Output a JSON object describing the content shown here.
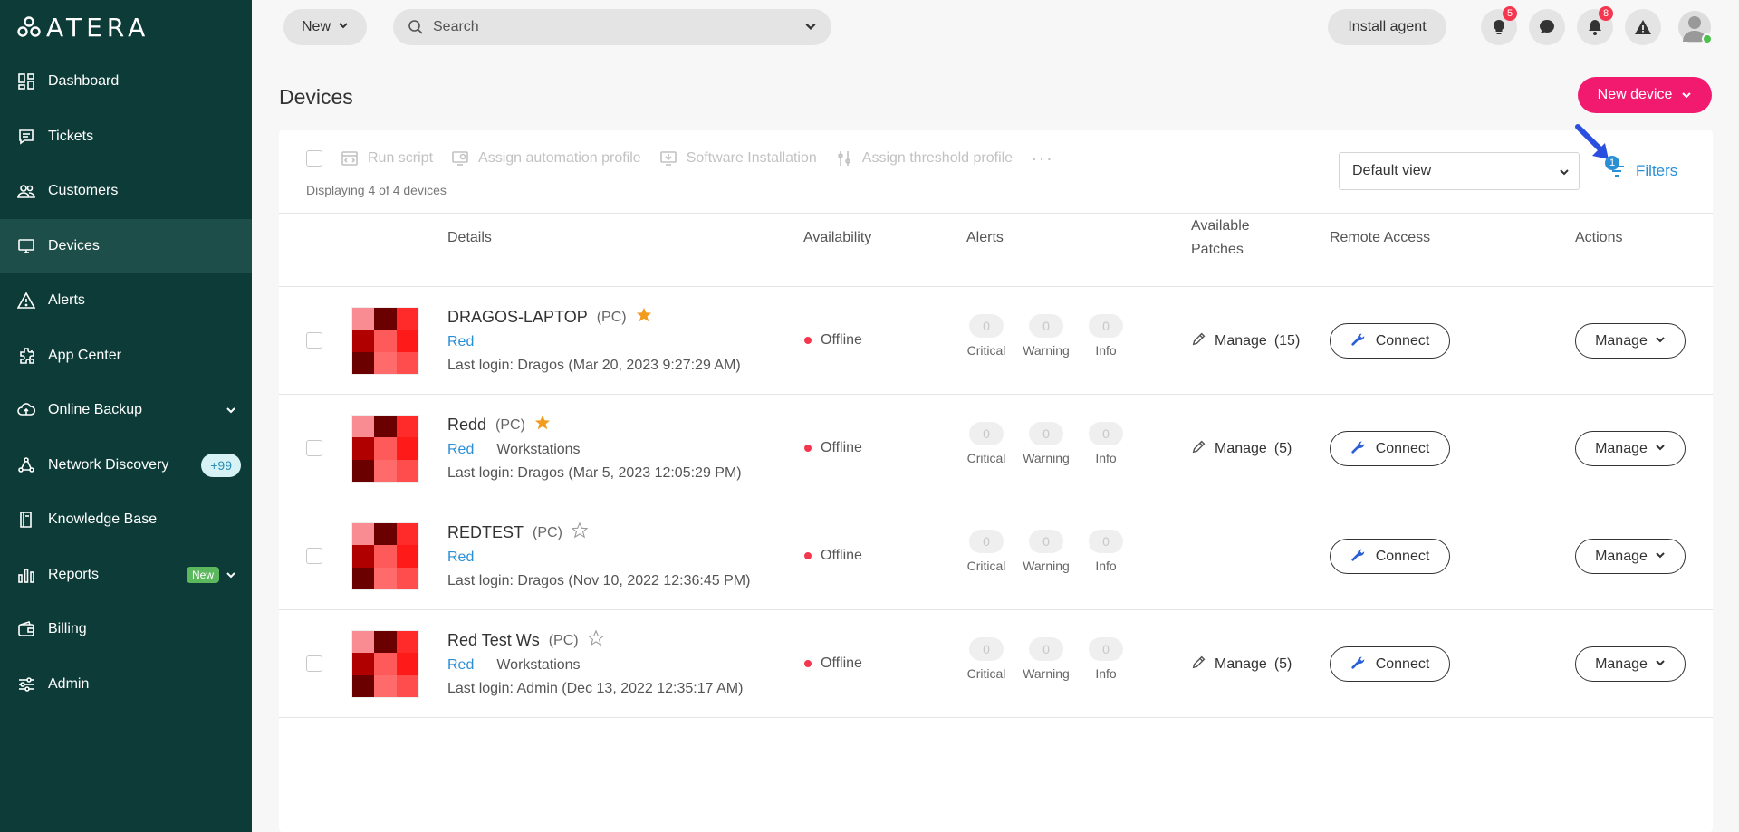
{
  "app": {
    "logo": "ATERA"
  },
  "sidebar": {
    "items": [
      {
        "label": "Dashboard",
        "icon": "dashboard-icon"
      },
      {
        "label": "Tickets",
        "icon": "ticket-icon"
      },
      {
        "label": "Customers",
        "icon": "customers-icon"
      },
      {
        "label": "Devices",
        "icon": "devices-icon",
        "active": true
      },
      {
        "label": "Alerts",
        "icon": "alert-icon"
      },
      {
        "label": "App Center",
        "icon": "puzzle-icon"
      },
      {
        "label": "Online Backup",
        "icon": "cloud-icon"
      },
      {
        "label": "Network Discovery",
        "icon": "network-icon",
        "badge": "+99"
      },
      {
        "label": "Knowledge Base",
        "icon": "book-icon"
      },
      {
        "label": "Reports",
        "icon": "reports-icon",
        "badge": "New"
      },
      {
        "label": "Billing",
        "icon": "wallet-icon"
      },
      {
        "label": "Admin",
        "icon": "sliders-icon"
      }
    ]
  },
  "topbar": {
    "new_label": "New",
    "search_placeholder": "Search",
    "install_label": "Install agent",
    "tips_count": "5",
    "notifications_count": "8"
  },
  "page": {
    "title": "Devices",
    "new_device_label": "New device"
  },
  "toolbar": {
    "run_script": "Run script",
    "assign_automation": "Assign automation profile",
    "software_install": "Software Installation",
    "assign_threshold": "Assign threshold profile",
    "more": "···",
    "displaying": "Displaying 4 of 4 devices",
    "view": "Default view",
    "filters_label": "Filters",
    "filters_count": "1"
  },
  "columns": {
    "details": "Details",
    "availability": "Availability",
    "alerts": "Alerts",
    "patches_1": "Available",
    "patches_2": "Patches",
    "remote": "Remote Access",
    "actions": "Actions"
  },
  "alert_labels": {
    "critical": "Critical",
    "warning": "Warning",
    "info": "Info"
  },
  "devices": [
    {
      "name": "DRAGOS-LAPTOP",
      "type": "(PC)",
      "starred": true,
      "customer": "Red",
      "site": "",
      "login": "Last login: Dragos (Mar 20, 2023 9:27:29 AM)",
      "availability": "Offline",
      "critical": "0",
      "warning": "0",
      "info": "0",
      "patches": "Manage",
      "patch_count": "(15)",
      "connect": "Connect",
      "manage": "Manage"
    },
    {
      "name": "Redd",
      "type": "(PC)",
      "starred": true,
      "customer": "Red",
      "site": "Workstations",
      "login": "Last login: Dragos (Mar 5, 2023 12:05:29 PM)",
      "availability": "Offline",
      "critical": "0",
      "warning": "0",
      "info": "0",
      "patches": "Manage",
      "patch_count": "(5)",
      "connect": "Connect",
      "manage": "Manage"
    },
    {
      "name": "REDTEST",
      "type": "(PC)",
      "starred": false,
      "customer": "Red",
      "site": "",
      "login": "Last login: Dragos (Nov 10, 2022 12:36:45 PM)",
      "availability": "Offline",
      "critical": "0",
      "warning": "0",
      "info": "0",
      "patches": "",
      "patch_count": "",
      "connect": "Connect",
      "manage": "Manage"
    },
    {
      "name": "Red Test Ws",
      "type": "(PC)",
      "starred": false,
      "customer": "Red",
      "site": "Workstations",
      "login": "Last login: Admin (Dec 13, 2022 12:35:17 AM)",
      "availability": "Offline",
      "critical": "0",
      "warning": "0",
      "info": "0",
      "patches": "Manage",
      "patch_count": "(5)",
      "connect": "Connect",
      "manage": "Manage"
    }
  ],
  "colors": {
    "sidebar": "#0d3c38",
    "accent": "#f21a6f",
    "link": "#2b8fd6",
    "offline": "#f5364f",
    "star": "#f29b1d"
  }
}
